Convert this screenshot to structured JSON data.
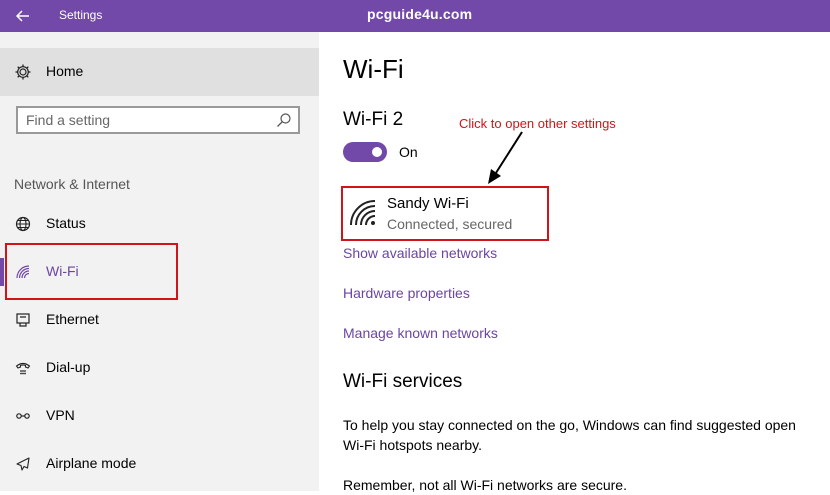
{
  "titlebar": {
    "app_title": "Settings",
    "watermark": "pcguide4u.com",
    "back_icon": "arrow-left-icon"
  },
  "sidebar": {
    "home": {
      "label": "Home",
      "icon": "gear-icon"
    },
    "search": {
      "placeholder": "Find a setting",
      "value": "",
      "icon": "search-icon"
    },
    "section_label": "Network & Internet",
    "items": [
      {
        "label": "Status",
        "icon": "globe-icon",
        "active": false
      },
      {
        "label": "Wi-Fi",
        "icon": "wifi-icon",
        "active": true
      },
      {
        "label": "Ethernet",
        "icon": "ethernet-icon",
        "active": false
      },
      {
        "label": "Dial-up",
        "icon": "dialup-icon",
        "active": false
      },
      {
        "label": "VPN",
        "icon": "vpn-icon",
        "active": false
      },
      {
        "label": "Airplane mode",
        "icon": "airplane-icon",
        "active": false
      }
    ]
  },
  "main": {
    "title": "Wi-Fi",
    "adapter_name": "Wi-Fi 2",
    "toggle": {
      "state": "On",
      "on": true
    },
    "network": {
      "ssid": "Sandy Wi-Fi",
      "status": "Connected, secured",
      "icon": "wifi-signal-icon"
    },
    "annotation": "Click to open other settings",
    "links": [
      "Show available networks",
      "Hardware properties",
      "Manage known networks"
    ],
    "services": {
      "title": "Wi-Fi services",
      "paragraph1": "To help you stay connected on the go, Windows can find suggested open Wi-Fi hotspots nearby.",
      "paragraph2": "Remember, not all Wi-Fi networks are secure."
    }
  },
  "colors": {
    "accent": "#7248a8",
    "highlight_red": "#d0141a",
    "sidebar_bg": "#f2f2f2"
  }
}
